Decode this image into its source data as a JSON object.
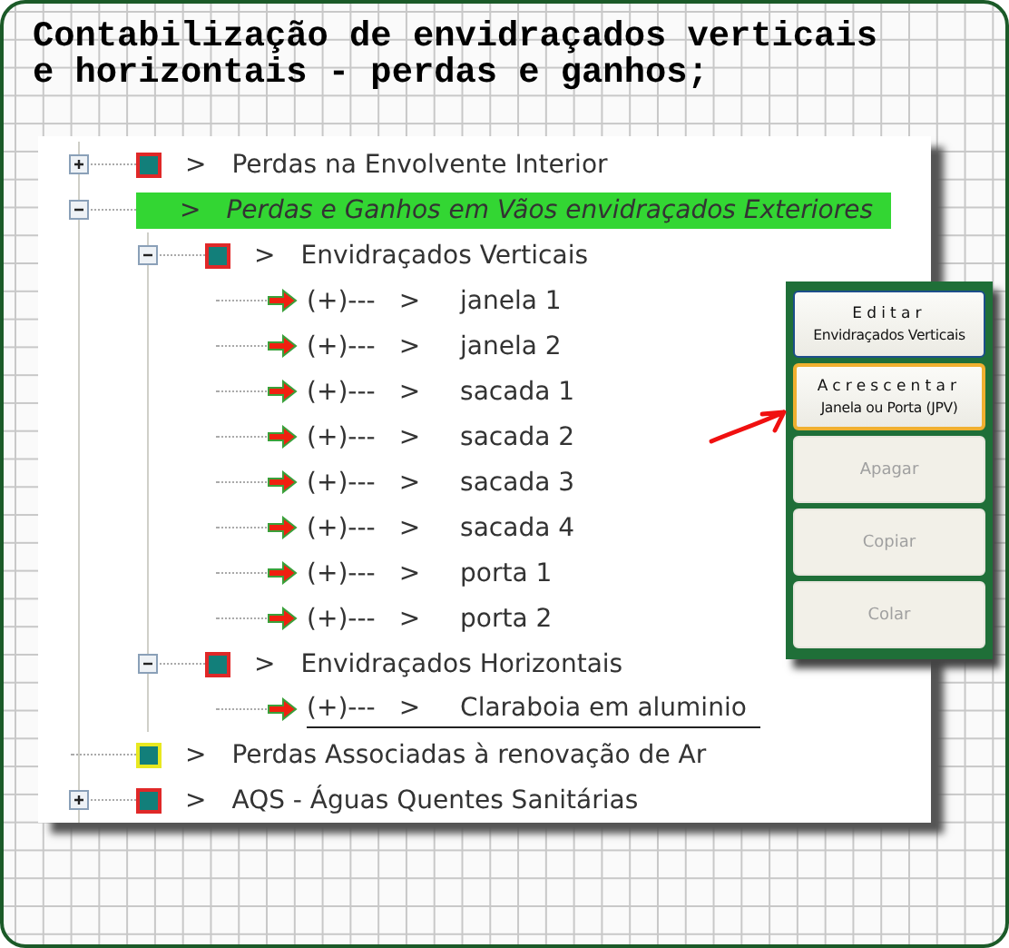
{
  "title": "Contabilização de envidraçados verticais e horizontais - perdas e ganhos;",
  "tree": [
    {
      "kind": "folder",
      "expanded": false,
      "selected": false,
      "focused": false,
      "color": "#e02828",
      "chevron": ">",
      "label": "Perdas na Envolvente Interior"
    },
    {
      "kind": "folder",
      "expanded": true,
      "selected": true,
      "focused": false,
      "chevron": ">",
      "label": "Perdas  e Ganhos em Vãos envidraçados Exteriores",
      "children": [
        {
          "kind": "folder",
          "expanded": true,
          "selected": false,
          "focused": false,
          "color": "#e02828",
          "chevron": ">",
          "label": "Envidraçados Verticais",
          "children": [
            {
              "kind": "leaf",
              "selected": false,
              "focused": false,
              "prefix": "(+)---",
              "chevron": ">",
              "label": "janela  1"
            },
            {
              "kind": "leaf",
              "selected": false,
              "focused": false,
              "prefix": "(+)---",
              "chevron": ">",
              "label": "janela 2"
            },
            {
              "kind": "leaf",
              "selected": false,
              "focused": false,
              "prefix": "(+)---",
              "chevron": ">",
              "label": "sacada 1"
            },
            {
              "kind": "leaf",
              "selected": false,
              "focused": false,
              "prefix": "(+)---",
              "chevron": ">",
              "label": "sacada 2"
            },
            {
              "kind": "leaf",
              "selected": false,
              "focused": false,
              "prefix": "(+)---",
              "chevron": ">",
              "label": "sacada 3"
            },
            {
              "kind": "leaf",
              "selected": false,
              "focused": false,
              "prefix": "(+)---",
              "chevron": ">",
              "label": "sacada 4"
            },
            {
              "kind": "leaf",
              "selected": false,
              "focused": false,
              "prefix": "(+)---",
              "chevron": ">",
              "label": "porta 1"
            },
            {
              "kind": "leaf",
              "selected": false,
              "focused": false,
              "prefix": "(+)---",
              "chevron": ">",
              "label": "porta 2"
            }
          ]
        },
        {
          "kind": "folder",
          "expanded": true,
          "selected": false,
          "focused": false,
          "color": "#e02828",
          "chevron": ">",
          "label": "Envidraçados Horizontais",
          "children": [
            {
              "kind": "leaf",
              "selected": false,
              "focused": true,
              "prefix": "(+)---",
              "chevron": ">",
              "label": "Claraboia em aluminio"
            }
          ]
        }
      ]
    },
    {
      "kind": "item",
      "selected": false,
      "focused": false,
      "color": "#e8e820",
      "chevron": ">",
      "label": "Perdas Associadas à renovação de Ar"
    },
    {
      "kind": "folder",
      "expanded": false,
      "selected": false,
      "focused": false,
      "color": "#e02828",
      "chevron": ">",
      "label": "AQS - Águas Quentes Sanitárias"
    }
  ],
  "buttons": [
    {
      "label": "Editar",
      "sublabel": "Envidraçados Verticais",
      "disabled": false,
      "hovered": false
    },
    {
      "label": "Acrescentar",
      "sublabel": "Janela ou Porta (JPV)",
      "disabled": false,
      "hovered": true
    },
    {
      "label": "Apagar",
      "disabled": true,
      "hovered": false
    },
    {
      "label": "Copiar",
      "disabled": true,
      "hovered": false
    },
    {
      "label": "Colar",
      "disabled": true,
      "hovered": false
    }
  ]
}
